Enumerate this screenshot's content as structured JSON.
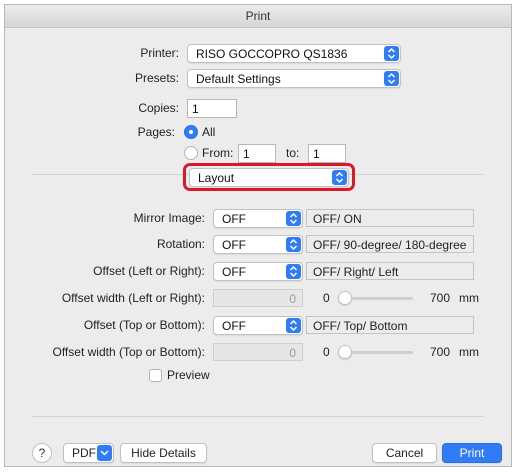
{
  "window": {
    "title": "Print"
  },
  "printer": {
    "label": "Printer:",
    "value": "RISO GOCCOPRO QS1836"
  },
  "presets": {
    "label": "Presets:",
    "value": "Default Settings"
  },
  "copies": {
    "label": "Copies:",
    "value": "1"
  },
  "pages": {
    "label": "Pages:",
    "all_label": "All",
    "from_label": "From:",
    "from_value": "1",
    "to_label": "to:",
    "to_value": "1",
    "selected": "All"
  },
  "panel_select": {
    "value": "Layout"
  },
  "mirror": {
    "label": "Mirror Image:",
    "value": "OFF",
    "hint": "OFF/ ON"
  },
  "rotation": {
    "label": "Rotation:",
    "value": "OFF",
    "hint": "OFF/ 90-degree/ 180-degree"
  },
  "offset_lr": {
    "label": "Offset (Left or Right):",
    "value": "OFF",
    "hint": "OFF/ Right/ Left"
  },
  "offset_width_lr": {
    "label": "Offset width (Left or Right):",
    "value": "0",
    "min": "0",
    "max": "700",
    "unit": "mm",
    "level": 0
  },
  "offset_tb": {
    "label": "Offset (Top or Bottom):",
    "value": "OFF",
    "hint": "OFF/ Top/ Bottom"
  },
  "offset_width_tb": {
    "label": "Offset width (Top or Bottom):",
    "value": "0",
    "min": "0",
    "max": "700",
    "unit": "mm",
    "level": 0
  },
  "preview": {
    "label": "Preview",
    "checked": false
  },
  "footer": {
    "help": "?",
    "pdf": "PDF",
    "hide_details": "Hide Details",
    "cancel": "Cancel",
    "print": "Print"
  },
  "colors": {
    "accent": "#2f7cf6",
    "highlight": "#d8192a"
  },
  "icons": {
    "chevron": "up-down-chevron-icon",
    "pdf_menu": "chevron-down-icon",
    "help": "help-icon"
  }
}
